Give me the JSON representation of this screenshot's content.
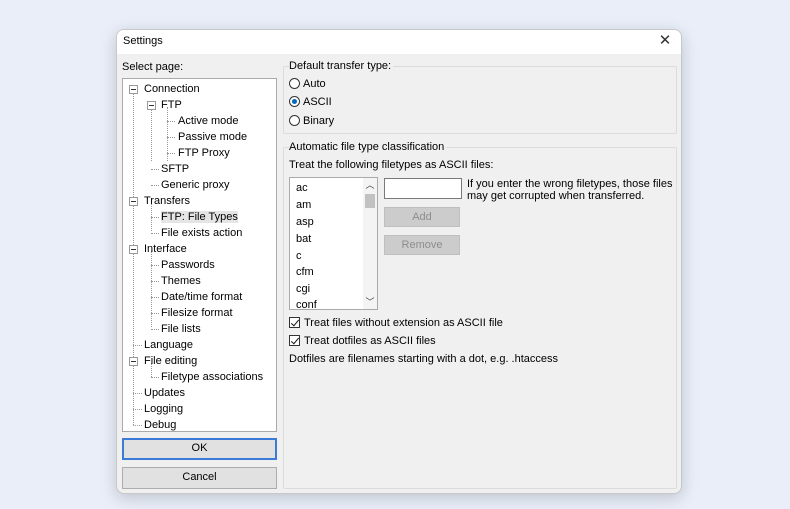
{
  "window": {
    "title": "Settings"
  },
  "sidebar": {
    "label": "Select page:",
    "items": [
      {
        "label": "Connection"
      },
      {
        "label": "FTP"
      },
      {
        "label": "Active mode"
      },
      {
        "label": "Passive mode"
      },
      {
        "label": "FTP Proxy"
      },
      {
        "label": "SFTP"
      },
      {
        "label": "Generic proxy"
      },
      {
        "label": "Transfers"
      },
      {
        "label": "FTP: File Types"
      },
      {
        "label": "File exists action"
      },
      {
        "label": "Interface"
      },
      {
        "label": "Passwords"
      },
      {
        "label": "Themes"
      },
      {
        "label": "Date/time format"
      },
      {
        "label": "Filesize format"
      },
      {
        "label": "File lists"
      },
      {
        "label": "Language"
      },
      {
        "label": "File editing"
      },
      {
        "label": "Filetype associations"
      },
      {
        "label": "Updates"
      },
      {
        "label": "Logging"
      },
      {
        "label": "Debug"
      }
    ],
    "selected": "FTP: File Types"
  },
  "buttons": {
    "ok": "OK",
    "cancel": "Cancel",
    "add": "Add",
    "remove": "Remove"
  },
  "transfer_type": {
    "label": "Default transfer type:",
    "options": [
      "Auto",
      "ASCII",
      "Binary"
    ],
    "selected": "ASCII"
  },
  "classification": {
    "label": "Automatic file type classification",
    "list_label": "Treat the following filetypes as ASCII files:",
    "filetypes": [
      "ac",
      "am",
      "asp",
      "bat",
      "c",
      "cfm",
      "cgi",
      "conf"
    ],
    "new_type_value": "",
    "hint": "If you enter the wrong filetypes, those files may get corrupted when transferred.",
    "check_no_ext": "Treat files without extension as ASCII file",
    "check_dotfiles": "Treat dotfiles as ASCII files",
    "dotfiles_note": "Dotfiles are filenames starting with a dot, e.g. .htaccess"
  }
}
